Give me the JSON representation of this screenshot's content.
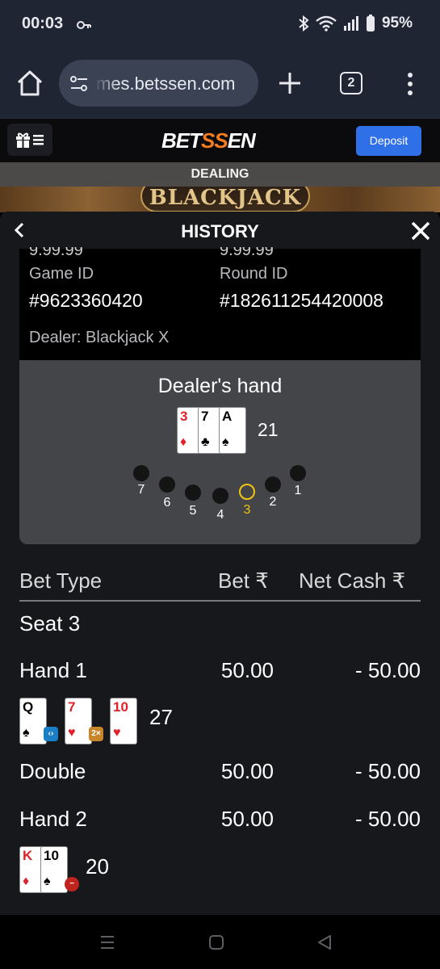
{
  "status_bar": {
    "time": "00:03",
    "battery": "95%"
  },
  "browser": {
    "url": "mes.betssen.com",
    "tab_count": "2"
  },
  "site": {
    "logo_prefix": "BET",
    "logo_accent": "SS",
    "logo_suffix": "EN",
    "deposit_label": "Deposit",
    "status_label": "DEALING",
    "game_title": "BLACKJACK"
  },
  "history": {
    "title": "HISTORY",
    "cut_left": "9.99.99",
    "cut_right": "9.99.99",
    "game_id_label": "Game ID",
    "game_id": "#9623360420",
    "round_id_label": "Round ID",
    "round_id": "#182611254420008",
    "dealer_name": "Dealer: Blackjack X",
    "dealer_hand_label": "Dealer's hand",
    "dealer_cards": [
      {
        "rank": "3",
        "suit": "♦",
        "color": "#e3202a"
      },
      {
        "rank": "7",
        "suit": "♣",
        "color": "#000000"
      },
      {
        "rank": "A",
        "suit": "♠",
        "color": "#000000"
      }
    ],
    "dealer_total": "21",
    "seats": [
      "7",
      "6",
      "5",
      "4",
      "3",
      "2",
      "1"
    ],
    "active_seat": "3",
    "table": {
      "headers": {
        "bet_type": "Bet Type",
        "bet": "Bet ₹",
        "net_cash": "Net Cash ₹"
      },
      "seat_label": "Seat 3",
      "rows": [
        {
          "type": "Hand 1",
          "bet": "50.00",
          "net": "- 50.00"
        },
        {
          "type": "Double",
          "bet": "50.00",
          "net": "- 50.00"
        },
        {
          "type": "Hand 2",
          "bet": "50.00",
          "net": "- 50.00"
        }
      ],
      "hand1_cards": [
        {
          "rank": "Q",
          "suit": "♠",
          "color": "#000000"
        },
        {
          "rank": "7",
          "suit": "♥",
          "color": "#e3202a"
        },
        {
          "rank": "10",
          "suit": "♥",
          "color": "#e3202a"
        }
      ],
      "hand1_badges": [
        "split",
        "2x"
      ],
      "hand1_total": "27",
      "hand2_cards": [
        {
          "rank": "K",
          "suit": "♦",
          "color": "#e3202a"
        },
        {
          "rank": "10",
          "suit": "♠",
          "color": "#000000"
        }
      ],
      "hand2_badge": "minus",
      "hand2_total": "20"
    }
  },
  "colors": {
    "accent": "#2f6fe8",
    "logo_accent": "#f47c20",
    "active_seat": "#f1c40f",
    "red_suit": "#e3202a"
  }
}
